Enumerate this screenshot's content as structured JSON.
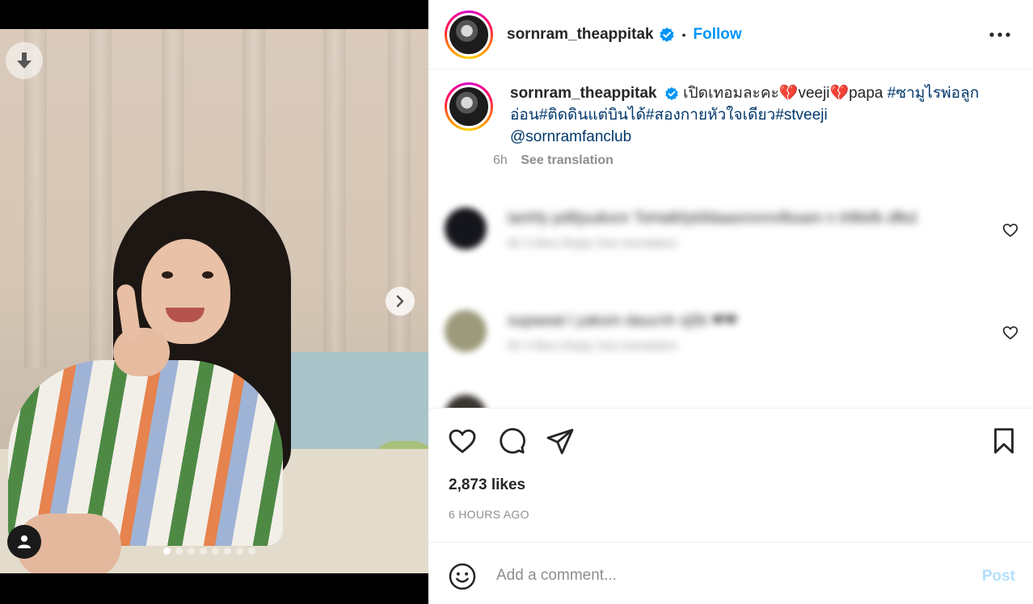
{
  "post": {
    "username": "sornram_theappitak",
    "follow_label": "Follow",
    "separator": "•",
    "caption": {
      "plain_1": " เปิดเทอมละคะ💔veeji💔papa ",
      "tag_1": "#ซามูไรพ่อลูกอ่อน",
      "tag_2": "#ติดดินแต่บินได้",
      "tag_3": "#สองกายหัวใจเดียว",
      "tag_4": "#stveeji",
      "mention": "@sornramfanclub"
    },
    "time": "6h",
    "see_translation": "See translation",
    "likes": "2,873 likes",
    "posted_ago": "6 HOURS AGO"
  },
  "comments": [
    {
      "text": "lanhfy pdfijsuiksnr ToHalkfykifdaasnnrnnfbsam n ihfkkfk dfkd",
      "meta": "6h   3 likes   Reply   See translation"
    },
    {
      "text": "supawat l yaksm daucnh sj5k ❤❤",
      "meta": "6h   4 likes   Reply   See translation"
    }
  ],
  "comment_box": {
    "placeholder": "Add a comment...",
    "post_label": "Post"
  },
  "carousel": {
    "slide_count": 8,
    "active_index": 0
  },
  "colors": {
    "accent_blue": "#0095f6",
    "hashtag": "#00376b",
    "muted": "#8e8e8e",
    "post_disabled": "#b2dffc"
  },
  "icons": {
    "download": "download-icon",
    "next": "chevron-right-icon",
    "tagged_user": "user-icon",
    "verified": "verified-badge-icon",
    "more": "more-horizontal-icon",
    "like": "heart-icon",
    "comment": "comment-icon",
    "share": "send-icon",
    "save": "bookmark-icon",
    "emoji": "smiley-icon"
  }
}
